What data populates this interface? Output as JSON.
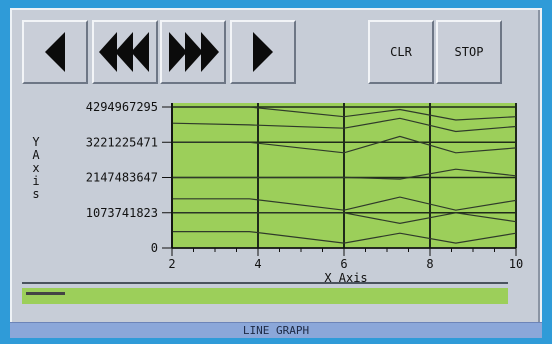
{
  "toolbar": {
    "buttons": [
      {
        "name": "step-back-button",
        "icon": "single-left-arrow-icon"
      },
      {
        "name": "fast-back-button",
        "icon": "triple-left-arrow-icon"
      },
      {
        "name": "fast-forward-button",
        "icon": "triple-right-arrow-icon"
      },
      {
        "name": "step-forward-button",
        "icon": "single-right-arrow-icon"
      }
    ],
    "clr_label": "CLR",
    "stop_label": "STOP"
  },
  "colors": {
    "plot_background": "#9ccf5a",
    "plot_lines": "#2f3a2a",
    "panel": "#c7cdd7",
    "outer": "#2f9bd8",
    "status_bar": "#8ba7d9"
  },
  "chart_data": {
    "type": "line",
    "title": "",
    "xlabel": "X Axis",
    "ylabel": "Y Axis",
    "xlim": [
      2,
      10
    ],
    "ylim": [
      0,
      4294967295
    ],
    "x_ticks": [
      "2",
      "4",
      "6",
      "8",
      "10"
    ],
    "y_ticks": [
      "4294967295",
      "3221225471",
      "2147483647",
      "1073741823",
      "0"
    ],
    "grid": true,
    "x": [
      2,
      3.8,
      6,
      7.3,
      8.6,
      10
    ],
    "series": [
      {
        "values": [
          4294967295,
          4294967295,
          4000000000,
          4220000000,
          3900000000,
          4000000000
        ]
      },
      {
        "values": [
          3800000000,
          3750000000,
          3650000000,
          3950000000,
          3550000000,
          3700000000
        ]
      },
      {
        "values": [
          3221225471,
          3221225471,
          2900000000,
          3400000000,
          2900000000,
          3050000000
        ]
      },
      {
        "values": [
          2147483647,
          2147483647,
          2150000000,
          2100000000,
          2400000000,
          2200000000
        ]
      },
      {
        "values": [
          1500000000,
          1500000000,
          1150000000,
          1550000000,
          1150000000,
          1450000000
        ]
      },
      {
        "values": [
          1073741823,
          1073741823,
          1073741823,
          750000000,
          1073741823,
          800000000
        ]
      },
      {
        "values": [
          500000000,
          500000000,
          150000000,
          450000000,
          150000000,
          450000000
        ]
      }
    ]
  },
  "track": {
    "fill_fraction": 0.08
  },
  "status": {
    "label": "LINE GRAPH"
  }
}
